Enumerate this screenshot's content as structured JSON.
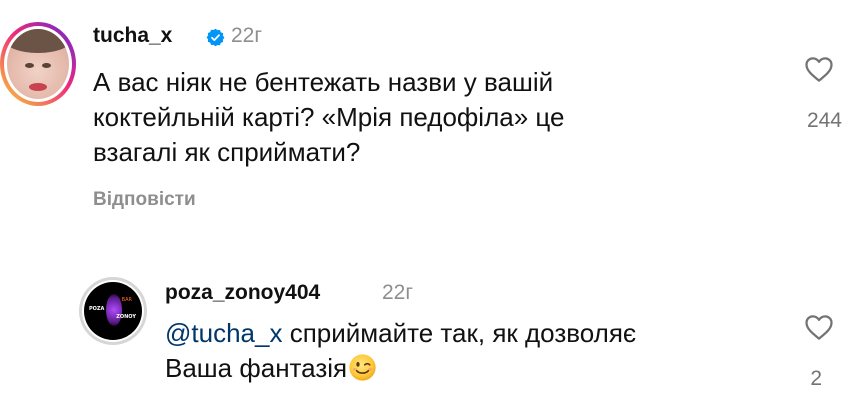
{
  "comments": [
    {
      "username": "tucha_x",
      "verified": true,
      "time": "22г",
      "text_lines": [
        "А вас ніяк не бентежать назви у вашій",
        "коктейльній карті? «Мрія педофіла» це",
        "взагалі як сприймати?"
      ],
      "reply_label": "Відповісти",
      "likes": "244",
      "avatar_icon": "profile-photo"
    },
    {
      "username": "poza_zonoy404",
      "verified": false,
      "time": "22г",
      "mention": "@tucha_x",
      "text_line1_rest": " сприймайте так, як дозволяє",
      "text_line2": "Ваша фантазія",
      "emoji": "winking-face",
      "likes": "2",
      "avatar_icon": "bar-logo",
      "avatar_logo_text": [
        "POZA",
        "ZONOY",
        "BAR"
      ]
    }
  ],
  "colors": {
    "text": "#111111",
    "secondary": "#8e8e8e",
    "mention": "#00376b",
    "verified": "#0095f6"
  }
}
